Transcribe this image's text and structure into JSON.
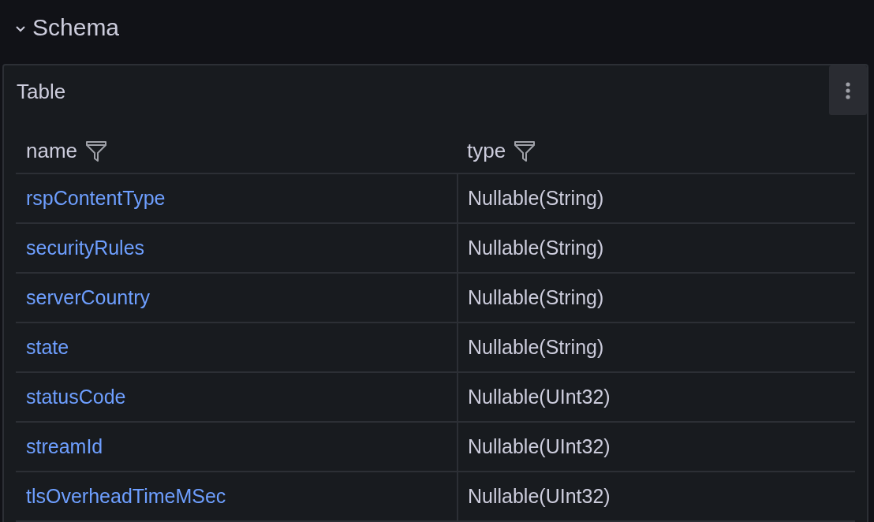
{
  "section": {
    "title": "Schema",
    "expanded": true
  },
  "panel": {
    "title": "Table"
  },
  "table": {
    "columns": [
      {
        "label": "name"
      },
      {
        "label": "type"
      }
    ],
    "rows": [
      {
        "name": "rspContentType",
        "type": "Nullable(String)"
      },
      {
        "name": "securityRules",
        "type": "Nullable(String)"
      },
      {
        "name": "serverCountry",
        "type": "Nullable(String)"
      },
      {
        "name": "state",
        "type": "Nullable(String)"
      },
      {
        "name": "statusCode",
        "type": "Nullable(UInt32)"
      },
      {
        "name": "streamId",
        "type": "Nullable(UInt32)"
      },
      {
        "name": "tlsOverheadTimeMSec",
        "type": "Nullable(UInt32)"
      }
    ]
  }
}
